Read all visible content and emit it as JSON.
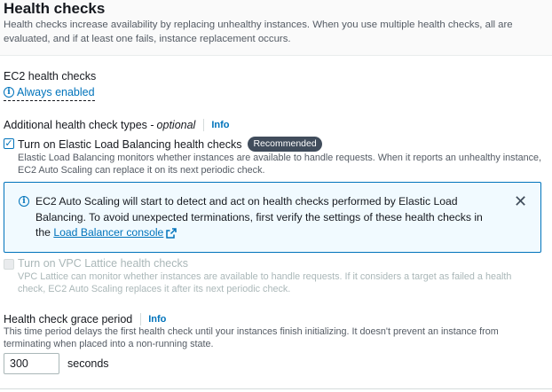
{
  "header": {
    "title": "Health checks",
    "description": "Health checks increase availability by replacing unhealthy instances. When you use multiple health checks, all are evaluated, and if at least one fails, instance replacement occurs."
  },
  "ec2": {
    "label": "EC2 health checks",
    "status": "Always enabled",
    "info_glyph": "i"
  },
  "additional": {
    "label": "Additional health check types - ",
    "optional": "optional",
    "info": "Info"
  },
  "elb": {
    "checked": true,
    "check_glyph": "✓",
    "label": "Turn on Elastic Load Balancing health checks",
    "badge": "Recommended",
    "description": "Elastic Load Balancing monitors whether instances are available to handle requests. When it reports an unhealthy instance, EC2 Auto Scaling can replace it on its next periodic check."
  },
  "alert": {
    "text": "EC2 Auto Scaling will start to detect and act on health checks performed by Elastic Load Balancing. To avoid unexpected terminations, first verify the settings of these health checks in the ",
    "link": "Load Balancer console",
    "close_glyph": "✕",
    "info_glyph": "i"
  },
  "vpc": {
    "checked": false,
    "label": "Turn on VPC Lattice health checks",
    "description": "VPC Lattice can monitor whether instances are available to handle requests. If it considers a target as failed a health check, EC2 Auto Scaling replaces it after its next periodic check."
  },
  "grace": {
    "label": "Health check grace period",
    "info": "Info",
    "description": "This time period delays the first health check until your instances finish initializing. It doesn't prevent an instance from terminating when placed into a non-running state.",
    "value": "300",
    "unit": "seconds"
  },
  "colors": {
    "link": "#0073bb",
    "alert_bg": "#f1faff",
    "badge_bg": "#414d5c",
    "disabled_text": "#aab7b8"
  }
}
